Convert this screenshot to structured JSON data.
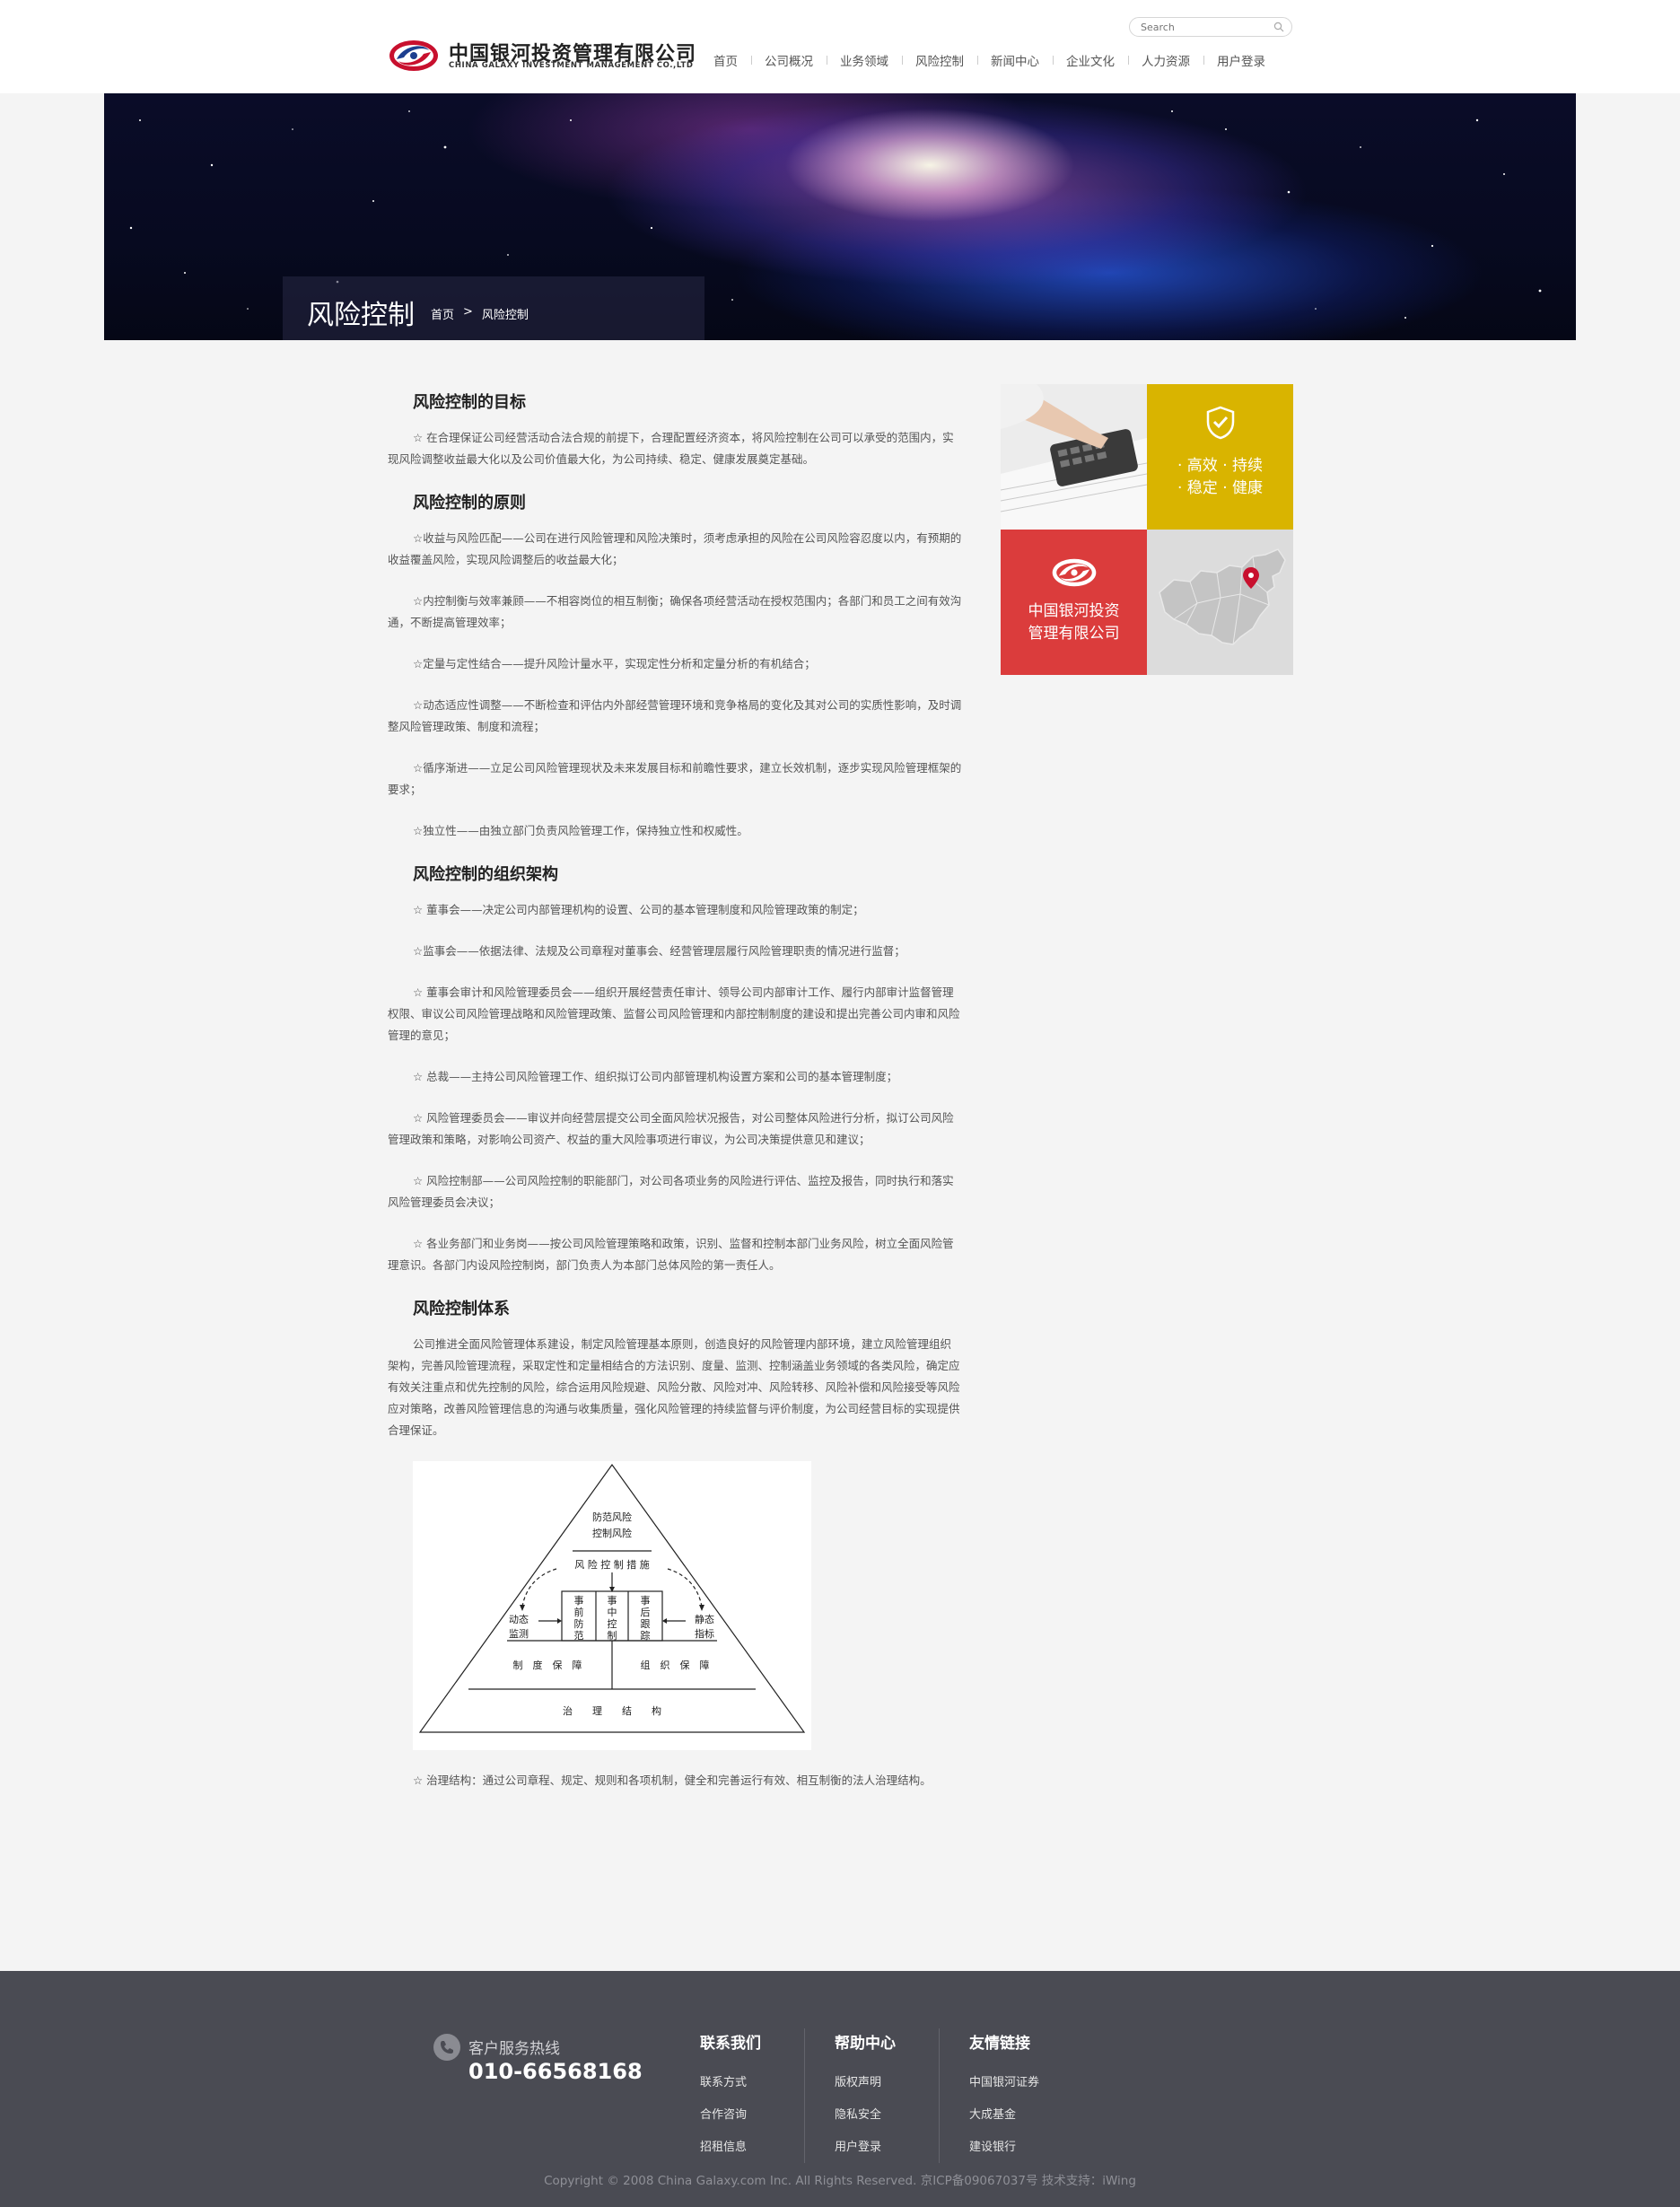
{
  "header": {
    "logo_cn": "中国银河投资管理有限公司",
    "logo_en": "CHINA GALAXY INVESTMENT MANAGEMENT CO.,LTD",
    "search_placeholder": "Search",
    "nav": [
      "首页",
      "公司概况",
      "业务领域",
      "风险控制",
      "新闻中心",
      "企业文化",
      "人力资源",
      "用户登录"
    ]
  },
  "banner": {
    "title": "风险控制",
    "breadcrumb": [
      "首页",
      ">",
      "风险控制"
    ]
  },
  "content": {
    "sections": [
      {
        "title": "风险控制的目标",
        "paragraphs": [
          "☆ 在合理保证公司经营活动合法合规的前提下，合理配置经济资本，将风险控制在公司可以承受的范围内，实现风险调整收益最大化以及公司价值最大化，为公司持续、稳定、健康发展奠定基础。"
        ]
      },
      {
        "title": "风险控制的原则",
        "paragraphs": [
          "☆收益与风险匹配——公司在进行风险管理和风险决策时，须考虑承担的风险在公司风险容忍度以内，有预期的收益覆盖风险，实现风险调整后的收益最大化；",
          "☆内控制衡与效率兼顾——不相容岗位的相互制衡；确保各项经营活动在授权范围内；各部门和员工之间有效沟通，不断提高管理效率；",
          "☆定量与定性结合——提升风险计量水平，实现定性分析和定量分析的有机结合；",
          "☆动态适应性调整——不断检查和评估内外部经营管理环境和竞争格局的变化及其对公司的实质性影响，及时调整风险管理政策、制度和流程；",
          "☆循序渐进——立足公司风险管理现状及未来发展目标和前瞻性要求，建立长效机制，逐步实现风险管理框架的要求；",
          "☆独立性——由独立部门负责风险管理工作，保持独立性和权威性。"
        ]
      },
      {
        "title": "风险控制的组织架构",
        "paragraphs": [
          "☆ 董事会——决定公司内部管理机构的设置、公司的基本管理制度和风险管理政策的制定；",
          "☆监事会——依据法律、法规及公司章程对董事会、经营管理层履行风险管理职责的情况进行监督；",
          "☆ 董事会审计和风险管理委员会——组织开展经营责任审计、领导公司内部审计工作、履行内部审计监督管理权限、审议公司风险管理战略和风险管理政策、监督公司风险管理和内部控制制度的建设和提出完善公司内审和风险管理的意见；",
          "☆ 总裁——主持公司风险管理工作、组织拟订公司内部管理机构设置方案和公司的基本管理制度；",
          "☆ 风险管理委员会——审议并向经营层提交公司全面风险状况报告，对公司整体风险进行分析，拟订公司风险管理政策和策略，对影响公司资产、权益的重大风险事项进行审议，为公司决策提供意见和建议；",
          "☆ 风险控制部——公司风险控制的职能部门，对公司各项业务的风险进行评估、监控及报告，同时执行和落实风险管理委员会决议；",
          "☆ 各业务部门和业务岗——按公司风险管理策略和政策，识别、监督和控制本部门业务风险，树立全面风险管理意识。各部门内设风险控制岗，部门负责人为本部门总体风险的第一责任人。"
        ]
      },
      {
        "title": "风险控制体系",
        "paragraphs": [
          "公司推进全面风险管理体系建设，制定风险管理基本原则，创造良好的风险管理内部环境，建立风险管理组织架构，完善风险管理流程，采取定性和定量相结合的方法识别、度量、监测、控制涵盖业务领域的各类风险，确定应有效关注重点和优先控制的风险，综合运用风险规避、风险分散、风险对冲、风险转移、风险补偿和风险接受等风险应对策略，改善风险管理信息的沟通与收集质量，强化风险管理的持续监督与评价制度，为公司经营目标的实现提供合理保证。"
        ]
      }
    ],
    "pyramid": {
      "top1": "防范风险",
      "top2": "控制风险",
      "measures": "风 险 控 制 措 施",
      "dynamic": [
        "动态",
        "监测"
      ],
      "static": [
        "静态",
        "指标"
      ],
      "pre": [
        "事",
        "前",
        "防",
        "范"
      ],
      "mid": [
        "事",
        "中",
        "控",
        "制"
      ],
      "post": [
        "事",
        "后",
        "跟",
        "踪"
      ],
      "system": "制　度　保　障",
      "org": "组　织　保　障",
      "gov": "治　　理　　结　　构"
    },
    "closing": "☆ 治理结构：通过公司章程、规定、规则和各项机制，健全和完善运行有效、相互制衡的法人治理结构。"
  },
  "sidebar": {
    "yellow_line1": "· 高效 · 持续",
    "yellow_line2": "· 稳定 · 健康",
    "red_line1": "中国银河投资",
    "red_line2": "管理有限公司"
  },
  "footer": {
    "hotline_label": "客户服务热线",
    "hotline_number": "010-66568168",
    "columns": [
      {
        "title": "联系我们",
        "links": [
          "联系方式",
          "合作咨询",
          "招租信息"
        ]
      },
      {
        "title": "帮助中心",
        "links": [
          "版权声明",
          "隐私安全",
          "用户登录"
        ]
      },
      {
        "title": "友情链接",
        "links": [
          "中国银河证券",
          "大成基金",
          "建设银行"
        ]
      }
    ],
    "copyright": "Copyright © 2008 China Galaxy.com Inc. All Rights Reserved. 京ICP备09067037号 技术支持：iWing"
  },
  "colors": {
    "accent_red": "#db3c3c",
    "accent_yellow": "#d9b400",
    "footer_bg": "#4a4b53"
  }
}
